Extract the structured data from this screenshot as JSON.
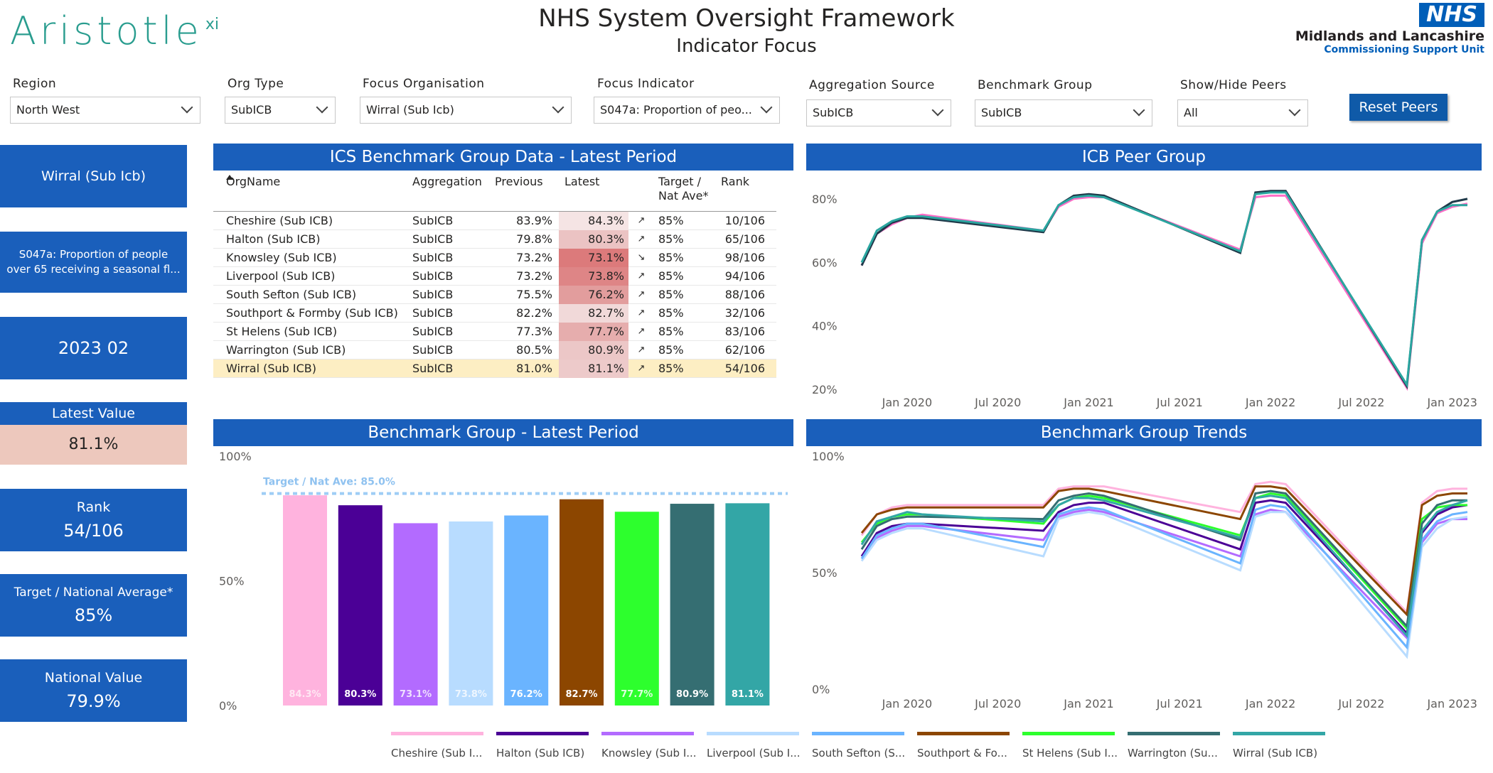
{
  "header": {
    "logo_text": "Aristotle",
    "logo_sup": "xi",
    "title": "NHS System Oversight Framework",
    "subtitle": "Indicator Focus",
    "nhs_badge": "NHS",
    "nhs_name": "Midlands and Lancashire",
    "nhs_unit": "Commissioning Support Unit"
  },
  "filters": [
    {
      "label": "Region",
      "value": "North West"
    },
    {
      "label": "Org Type",
      "value": "SubICB"
    },
    {
      "label": "Focus Organisation",
      "value": "Wirral (Sub Icb)"
    },
    {
      "label": "Focus Indicator",
      "value": "S047a: Proportion of peo..."
    },
    {
      "label": "Aggregation Source",
      "value": "SubICB"
    },
    {
      "label": "Benchmark Group",
      "value": "SubICB"
    },
    {
      "label": "Show/Hide Peers",
      "value": "All"
    }
  ],
  "reset_button": "Reset Peers",
  "cards": {
    "org": "Wirral (Sub Icb)",
    "indicator_line1": "S047a: Proportion of people",
    "indicator_line2": "over 65 receiving a seasonal fl...",
    "period": "2023 02",
    "latest_title": "Latest Value",
    "latest_value": "81.1%",
    "rank_title": "Rank",
    "rank_value": "54/106",
    "target_title": "Target / National Average*",
    "target_value": "85%",
    "national_title": "National Value",
    "national_value": "79.9%"
  },
  "table": {
    "title": "ICS Benchmark Group Data - Latest Period",
    "headers": {
      "org": "OrgName",
      "agg": "Aggregation",
      "prev": "Previous",
      "latest": "Latest",
      "target_l1": "Target /",
      "target_l2": "Nat Ave*",
      "rank": "Rank"
    },
    "rows": [
      {
        "org": "Cheshire (Sub ICB)",
        "agg": "SubICB",
        "prev": "83.9%",
        "latest": "84.3%",
        "arrow": "↗",
        "target": "85%",
        "rank": "10/106",
        "heat": "#f5e4e4"
      },
      {
        "org": "Halton (Sub ICB)",
        "agg": "SubICB",
        "prev": "79.8%",
        "latest": "80.3%",
        "arrow": "↗",
        "target": "85%",
        "rank": "65/106",
        "heat": "#ebc3c3"
      },
      {
        "org": "Knowsley (Sub ICB)",
        "agg": "SubICB",
        "prev": "73.2%",
        "latest": "73.1%",
        "arrow": "↘",
        "target": "85%",
        "rank": "98/106",
        "heat": "#dc7a7b"
      },
      {
        "org": "Liverpool (Sub ICB)",
        "agg": "SubICB",
        "prev": "73.2%",
        "latest": "73.8%",
        "arrow": "↗",
        "target": "85%",
        "rank": "94/106",
        "heat": "#de8586"
      },
      {
        "org": "South Sefton (Sub ICB)",
        "agg": "SubICB",
        "prev": "75.5%",
        "latest": "76.2%",
        "arrow": "↗",
        "target": "85%",
        "rank": "88/106",
        "heat": "#e29d9d"
      },
      {
        "org": "Southport & Formby (Sub ICB)",
        "agg": "SubICB",
        "prev": "82.2%",
        "latest": "82.7%",
        "arrow": "↗",
        "target": "85%",
        "rank": "32/106",
        "heat": "#f1d9d9"
      },
      {
        "org": "St Helens (Sub ICB)",
        "agg": "SubICB",
        "prev": "77.3%",
        "latest": "77.7%",
        "arrow": "↗",
        "target": "85%",
        "rank": "83/106",
        "heat": "#e6adad"
      },
      {
        "org": "Warrington (Sub ICB)",
        "agg": "SubICB",
        "prev": "80.5%",
        "latest": "80.9%",
        "arrow": "↗",
        "target": "85%",
        "rank": "62/106",
        "heat": "#ecc7c7"
      },
      {
        "org": "Wirral (Sub ICB)",
        "agg": "SubICB",
        "prev": "81.0%",
        "latest": "81.1%",
        "arrow": "↗",
        "target": "85%",
        "rank": "54/106",
        "heat": "#edcaca",
        "highlight": true
      }
    ]
  },
  "panels": {
    "peer_title": "ICB Peer Group",
    "bar_title": "Benchmark Group - Latest Period",
    "trend_title": "Benchmark Group Trends"
  },
  "colors": {
    "header_blue": "#1a5fbb",
    "series": [
      "#ffb3de",
      "#4b0096",
      "#b36bff",
      "#b8dcff",
      "#6ab4ff",
      "#8c4600",
      "#2dff2d",
      "#356e72",
      "#33a6a6"
    ]
  },
  "chart_data": [
    {
      "type": "line",
      "title": "ICB Peer Group",
      "x": [
        "2019-10",
        "2019-11",
        "2019-12",
        "2020-01",
        "2020-02",
        "2020-10",
        "2020-11",
        "2020-12",
        "2021-01",
        "2021-02",
        "2021-11",
        "2021-12",
        "2022-01",
        "2022-02",
        "2022-10",
        "2022-11",
        "2022-12",
        "2023-01",
        "2023-02"
      ],
      "xticks": [
        "Jan 2020",
        "Jul 2020",
        "Jan 2021",
        "Jul 2021",
        "Jan 2022",
        "Jul 2022",
        "Jan 2023"
      ],
      "yticks": [
        "20%",
        "40%",
        "60%",
        "80%"
      ],
      "ylim": [
        18,
        84
      ],
      "series": [
        {
          "values": [
            59,
            69,
            72,
            74,
            75,
            70,
            77.5,
            80,
            80.5,
            80.5,
            64,
            80.5,
            81,
            81,
            20.5,
            66,
            75.5,
            77.5,
            78.5
          ],
          "color": "#ff6ec7"
        },
        {
          "values": [
            59,
            69,
            72.5,
            74,
            74,
            69.5,
            78,
            81,
            81.5,
            81,
            63,
            82,
            82.5,
            82.5,
            21,
            67,
            76,
            79,
            80
          ],
          "color": "#1f3a4a"
        },
        {
          "values": [
            60,
            70,
            73,
            74.5,
            74.5,
            70,
            78,
            80.5,
            81,
            80.5,
            63.5,
            81.5,
            82,
            82,
            21.5,
            67,
            76,
            78,
            78
          ],
          "color": "#2aa6a0"
        }
      ]
    },
    {
      "type": "bar",
      "title": "Benchmark Group - Latest Period",
      "categories": [
        "Cheshire (Sub ICB)",
        "Halton (Sub ICB)",
        "Knowsley (Sub ICB)",
        "Liverpool (Sub ICB)",
        "South Sefton (Sub ICB)",
        "Southport & Formby (Sub ICB)",
        "St Helens (Sub ICB)",
        "Warrington (Sub ICB)",
        "Wirral (Sub ICB)"
      ],
      "values": [
        84.3,
        80.3,
        73.1,
        73.8,
        76.2,
        82.7,
        77.7,
        80.9,
        81.1
      ],
      "labels": [
        "84.3%",
        "80.3%",
        "73.1%",
        "73.8%",
        "76.2%",
        "82.7%",
        "77.7%",
        "80.9%",
        "81.1%"
      ],
      "yticks": [
        "0%",
        "50%",
        "100%"
      ],
      "ylim": [
        0,
        100
      ],
      "target": 85.0,
      "target_label": "Target / Nat Ave: 85.0%"
    },
    {
      "type": "line",
      "title": "Benchmark Group Trends",
      "x": [
        "2019-10",
        "2019-11",
        "2019-12",
        "2020-01",
        "2020-02",
        "2020-10",
        "2020-11",
        "2020-12",
        "2021-01",
        "2021-02",
        "2021-11",
        "2021-12",
        "2022-01",
        "2022-02",
        "2022-10",
        "2022-11",
        "2022-12",
        "2023-01",
        "2023-02"
      ],
      "xticks": [
        "Jan 2020",
        "Jul 2020",
        "Jan 2021",
        "Jul 2021",
        "Jan 2022",
        "Jul 2022",
        "Jan 2023"
      ],
      "yticks": [
        "0%",
        "50%",
        "100%"
      ],
      "ylim": [
        0,
        100
      ],
      "series": [
        {
          "name": "Cheshire (Sub I...",
          "values": [
            66,
            75,
            78,
            79,
            79,
            79,
            86,
            87,
            87,
            87,
            76,
            88,
            89,
            88,
            33,
            80,
            85,
            86,
            86
          ]
        },
        {
          "name": "Halton (Sub ICB)",
          "values": [
            57,
            67,
            70,
            71,
            71,
            68,
            76,
            79,
            80,
            80,
            60,
            80,
            81,
            80,
            24,
            67,
            75,
            78,
            79
          ]
        },
        {
          "name": "Knowsley (Sub I...",
          "values": [
            56,
            65,
            68,
            70,
            70,
            64,
            74,
            76,
            77,
            76,
            57,
            75,
            77,
            76,
            22,
            63,
            71,
            73,
            73
          ]
        },
        {
          "name": "Liverpool (Sub I...",
          "values": [
            55,
            64,
            67,
            69,
            69,
            57,
            73,
            75,
            76,
            75,
            51,
            74,
            76,
            76,
            14,
            61,
            69,
            73,
            74
          ]
        },
        {
          "name": "South Sefton (S...",
          "values": [
            56,
            66,
            69,
            71,
            71,
            61,
            75,
            77,
            78,
            77,
            54,
            77,
            79,
            78,
            18,
            64,
            72,
            75,
            76
          ]
        },
        {
          "name": "Southport & Fo...",
          "values": [
            67,
            75,
            77,
            78,
            78,
            78,
            85,
            86,
            86,
            85,
            73,
            87,
            87,
            86,
            32,
            79,
            83,
            84,
            84
          ]
        },
        {
          "name": "St Helens (Sub I...",
          "values": [
            63,
            71,
            74,
            75,
            75,
            71,
            79,
            82,
            83,
            82,
            66,
            82,
            84,
            83,
            26,
            73,
            78,
            79,
            79
          ]
        },
        {
          "name": "Warrington (Su...",
          "values": [
            60,
            70,
            73,
            74,
            74,
            73,
            81,
            83,
            84,
            83,
            64,
            84,
            85,
            84,
            27,
            71,
            79,
            81,
            81
          ]
        },
        {
          "name": "Wirral (Sub ICB)",
          "values": [
            62,
            72,
            74,
            76,
            75,
            72,
            79,
            82,
            82,
            81,
            65,
            82,
            83,
            82,
            23,
            68,
            76,
            79,
            81
          ]
        }
      ]
    }
  ]
}
